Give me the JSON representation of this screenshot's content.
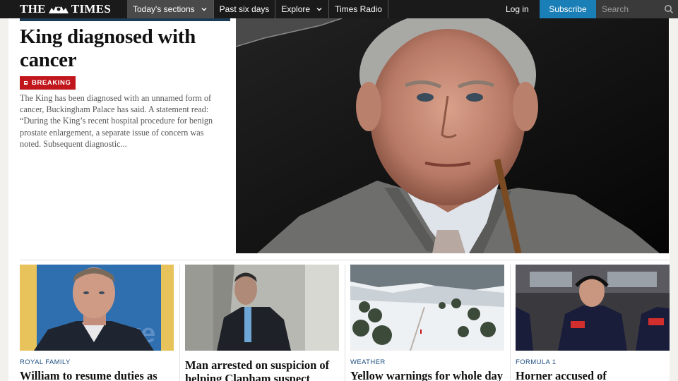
{
  "nav": {
    "logo_left": "THE",
    "logo_right": "TIMES",
    "sections_label": "Today's sections",
    "past_six_days": "Past six days",
    "explore_label": "Explore",
    "radio_label": "Times Radio",
    "login_label": "Log in",
    "subscribe_label": "Subscribe",
    "search_placeholder": "Search"
  },
  "hero": {
    "title": "King diagnosed with cancer",
    "badge": "BREAKING",
    "summary": "The King has been diagnosed with an unnamed form of cancer, Buckingham Palace has said. A statement read: “During the King’s recent hospital procedure for benign prostate enlargement, a separate issue of concern was noted. Subsequent diagnostic..."
  },
  "cards": [
    {
      "category": "ROYAL FAMILY",
      "headline": "William to resume duties as"
    },
    {
      "category": "",
      "headline": "Man arrested on suspicion of helping Clapham suspect"
    },
    {
      "category": "WEATHER",
      "headline": "Yellow warnings for whole day"
    },
    {
      "category": "FORMULA 1",
      "headline": "Horner accused of"
    }
  ],
  "colors": {
    "nav_bg": "#1a1a1a",
    "subscribe_bg": "#1a7fb6",
    "breaking_red": "#c0161c",
    "category_blue": "#1d4f80"
  }
}
